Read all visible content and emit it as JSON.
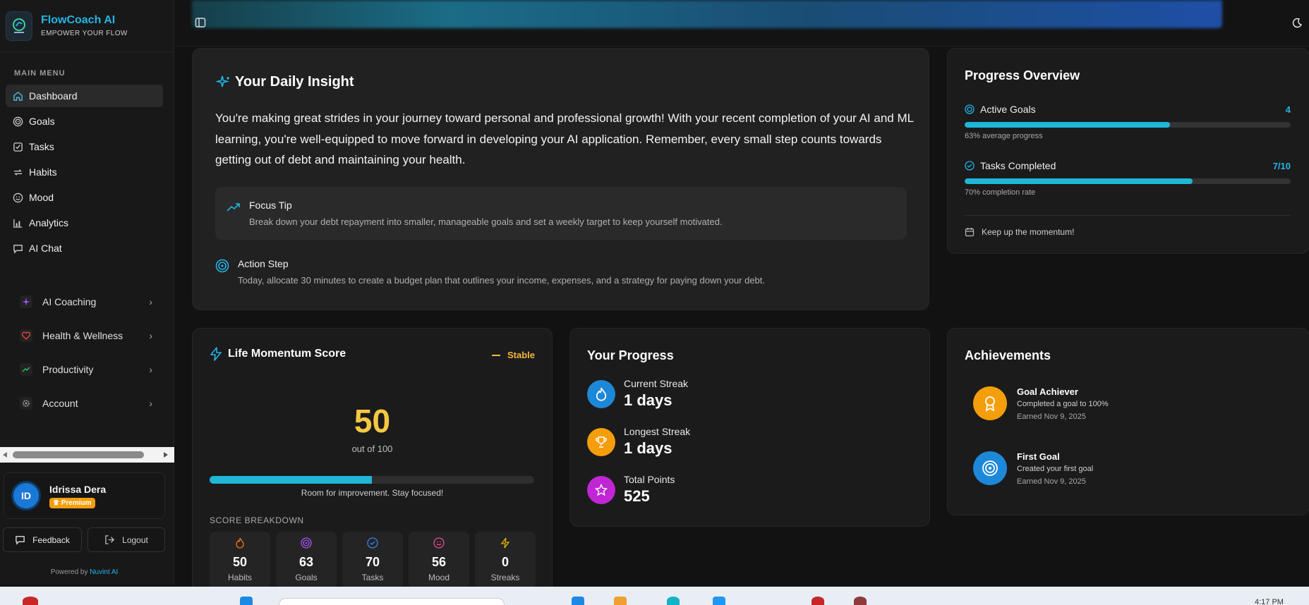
{
  "brand": {
    "title": "FlowCoach AI",
    "subtitle": "EMPOWER YOUR FLOW"
  },
  "sidebar": {
    "menu_title": "MAIN MENU",
    "items": [
      {
        "label": "Dashboard",
        "icon": "home-icon",
        "active": true
      },
      {
        "label": "Goals",
        "icon": "target-icon"
      },
      {
        "label": "Tasks",
        "icon": "checkbox-icon"
      },
      {
        "label": "Habits",
        "icon": "repeat-icon"
      },
      {
        "label": "Mood",
        "icon": "smile-icon"
      },
      {
        "label": "Analytics",
        "icon": "bar-chart-icon"
      },
      {
        "label": "AI Chat",
        "icon": "chat-icon"
      }
    ],
    "groups": [
      {
        "label": "AI Coaching",
        "icon": "sparkles-icon",
        "color": "#a855f7"
      },
      {
        "label": "Health & Wellness",
        "icon": "heart-pulse-icon",
        "color": "#ef4444"
      },
      {
        "label": "Productivity",
        "icon": "trending-up-icon",
        "color": "#22c55e"
      },
      {
        "label": "Account",
        "icon": "gear-icon",
        "color": "#9ca3af"
      }
    ],
    "user": {
      "initials": "ID",
      "name": "Idrissa Dera",
      "badge": "♛ Premium"
    },
    "feedback_label": "Feedback",
    "logout_label": "Logout",
    "powered_prefix": "Powered by",
    "powered_link": "Nuvint AI"
  },
  "insight": {
    "title": "Your Daily Insight",
    "text": "You're making great strides in your journey toward personal and professional growth! With your recent completion of your AI and ML learning, you're well-equipped to move forward in developing your AI application. Remember, every small step counts towards getting out of debt and maintaining your health.",
    "focus_title": "Focus Tip",
    "focus_text": "Break down your debt repayment into smaller, manageable goals and set a weekly target to keep yourself motivated.",
    "action_title": "Action Step",
    "action_text": "Today, allocate 30 minutes to create a budget plan that outlines your income, expenses, and a strategy for paying down your debt."
  },
  "progress_overview": {
    "title": "Progress Overview",
    "active_goals_label": "Active Goals",
    "active_goals_value": "4",
    "active_goals_progress": 0.63,
    "active_goals_sub": "63% average progress",
    "tasks_label": "Tasks Completed",
    "tasks_value": "7/10",
    "tasks_progress": 0.7,
    "tasks_sub": "70% completion rate",
    "footer": "Keep up the momentum!"
  },
  "momentum": {
    "title": "Life Momentum Score",
    "status": "Stable",
    "score": "50",
    "out_of": "out of 100",
    "progress": 0.5,
    "note": "Room for improvement. Stay focused!",
    "breakdown_title": "SCORE BREAKDOWN",
    "breakdown": [
      {
        "value": "50",
        "label": "Habits",
        "icon": "flame-icon",
        "color": "#f97316"
      },
      {
        "value": "63",
        "label": "Goals",
        "icon": "target-icon",
        "color": "#a855f7"
      },
      {
        "value": "70",
        "label": "Tasks",
        "icon": "check-circle-icon",
        "color": "#3b82f6"
      },
      {
        "value": "56",
        "label": "Mood",
        "icon": "smile-icon",
        "color": "#ec4899"
      },
      {
        "value": "0",
        "label": "Streaks",
        "icon": "lightning-icon",
        "color": "#eab308"
      }
    ]
  },
  "your_progress": {
    "title": "Your Progress",
    "stats": [
      {
        "label": "Current Streak",
        "value": "1 days",
        "icon": "flame-icon",
        "color": "#1e88d8"
      },
      {
        "label": "Longest Streak",
        "value": "1 days",
        "icon": "trophy-icon",
        "color": "#f59e0b"
      },
      {
        "label": "Total Points",
        "value": "525",
        "icon": "star-icon",
        "color": "#c026d3"
      }
    ]
  },
  "achievements": {
    "title": "Achievements",
    "items": [
      {
        "name": "Goal Achiever",
        "desc": "Completed a goal to 100%",
        "earned": "Earned Nov 9, 2025",
        "icon": "award-icon",
        "color": "#f59e0b"
      },
      {
        "name": "First Goal",
        "desc": "Created your first goal",
        "earned": "Earned Nov 9, 2025",
        "icon": "target-icon",
        "color": "#1e88d8"
      }
    ]
  },
  "taskbar": {
    "time": "4:17 PM"
  }
}
